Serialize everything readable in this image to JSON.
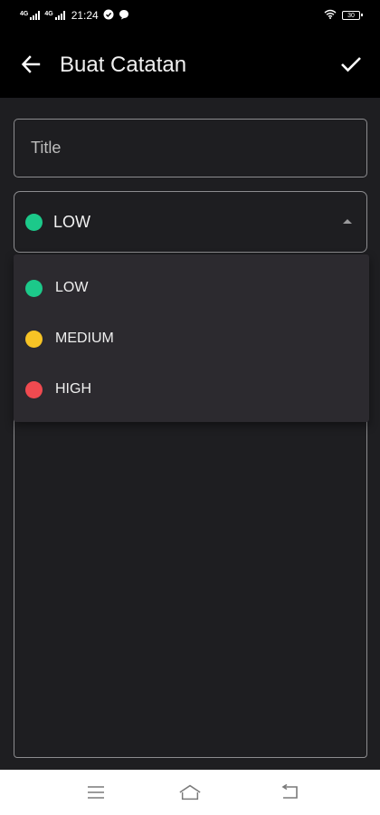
{
  "status_bar": {
    "signal1_label": "4G",
    "signal2_label": "4G",
    "time": "21:24",
    "battery": "30",
    "icons": [
      "sync-icon",
      "chat-bubble-icon",
      "wifi-icon",
      "battery-icon"
    ]
  },
  "app_bar": {
    "title": "Buat Catatan",
    "back_icon": "arrow-left-icon",
    "confirm_icon": "check-icon"
  },
  "form": {
    "title_placeholder": "Title",
    "title_value": "",
    "priority_selected": "LOW",
    "priority_selected_color": "#1cc98a"
  },
  "dropdown": {
    "options": [
      {
        "label": "LOW",
        "color": "#1cc98a"
      },
      {
        "label": "MEDIUM",
        "color": "#f7c325"
      },
      {
        "label": "HIGH",
        "color": "#f04a50"
      }
    ]
  },
  "nav_bar": {
    "icons": [
      "menu-icon",
      "home-icon",
      "back-icon"
    ]
  },
  "colors": {
    "background": "#1e1e21",
    "app_bar": "#000000",
    "dropdown_bg": "#2c2a2f",
    "border": "#8c8c8f"
  }
}
